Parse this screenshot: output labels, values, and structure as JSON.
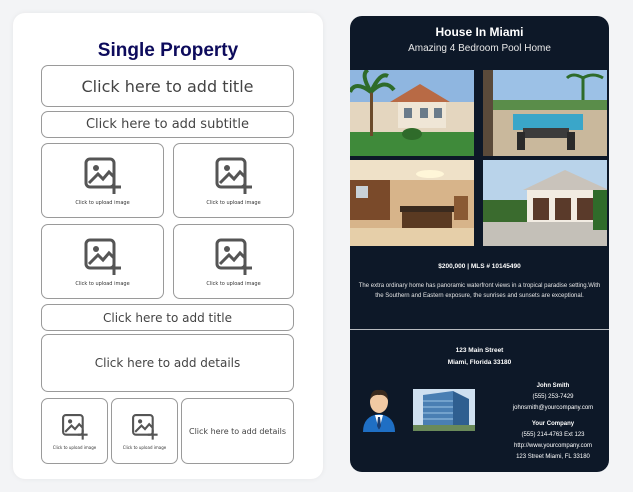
{
  "editor": {
    "heading": "Single Property",
    "add_title": "Click here to add title",
    "add_subtitle": "Click here to add subtitle",
    "upload_image": "Click to upload image",
    "add_title_2": "Click here to add title",
    "add_details": "Click here to add details",
    "add_details_2": "Click here to add details"
  },
  "flyer": {
    "title": "House In Miami",
    "subtitle": "Amazing 4 Bedroom Pool Home",
    "price_line": "$200,000 | MLS # 10145490",
    "description": "The extra ordinary home has panoramic waterfront views in a tropical paradise setting.With the Southern and Eastern exposure, the sunrises and sunsets are exceptional.",
    "address_line1": "123 Main Street",
    "address_line2": "Miami, Florida 33180",
    "agent_name": "John Smith",
    "agent_phone": "(555) 253-7429",
    "agent_email": "johnsmith@yourcompany.com",
    "company_name": "Your Company",
    "company_phone": "(555) 214-4763 Ext 123",
    "company_url": "http://www.yourcompany.com",
    "company_address": "123 Street Miami, FL 33180"
  },
  "colors": {
    "editor_heading": "#0d0b5c",
    "flyer_background": "#0d1828"
  },
  "icons": {
    "upload": "image-upload-icon",
    "agent": "agent-avatar-icon"
  }
}
